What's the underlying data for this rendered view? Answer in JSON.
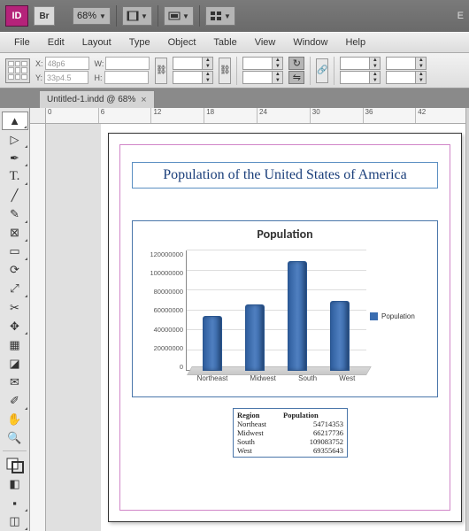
{
  "app": {
    "id_label": "ID",
    "bridge_label": "Br",
    "zoom": "68%"
  },
  "menus": [
    "File",
    "Edit",
    "Layout",
    "Type",
    "Object",
    "Table",
    "View",
    "Window",
    "Help"
  ],
  "control": {
    "x_label": "X:",
    "x_value": "48p6",
    "y_label": "Y:",
    "y_value": "33p4.5",
    "w_label": "W:",
    "w_value": "",
    "h_label": "H:",
    "h_value": ""
  },
  "tab": {
    "title": "Untitled-1.indd @ 68%"
  },
  "ruler_marks": [
    "0",
    "6",
    "12",
    "18",
    "24",
    "30",
    "36",
    "42"
  ],
  "doc": {
    "title": "Population of the United States of America",
    "table": {
      "header_region": "Region",
      "header_pop": "Population",
      "rows": [
        {
          "region": "Northeast",
          "pop": "54714353"
        },
        {
          "region": "Midwest",
          "pop": "66217736"
        },
        {
          "region": "South",
          "pop": "109083752"
        },
        {
          "region": "West",
          "pop": "69355643"
        }
      ]
    }
  },
  "chart_data": {
    "type": "bar",
    "title": "Population",
    "categories": [
      "Northeast",
      "Midwest",
      "South",
      "West"
    ],
    "series": [
      {
        "name": "Population",
        "values": [
          54714353,
          66217736,
          109083752,
          69355643
        ]
      }
    ],
    "ylim": [
      0,
      120000000
    ],
    "yticks": [
      0,
      20000000,
      40000000,
      60000000,
      80000000,
      100000000,
      120000000
    ],
    "xlabel": "",
    "ylabel": ""
  }
}
